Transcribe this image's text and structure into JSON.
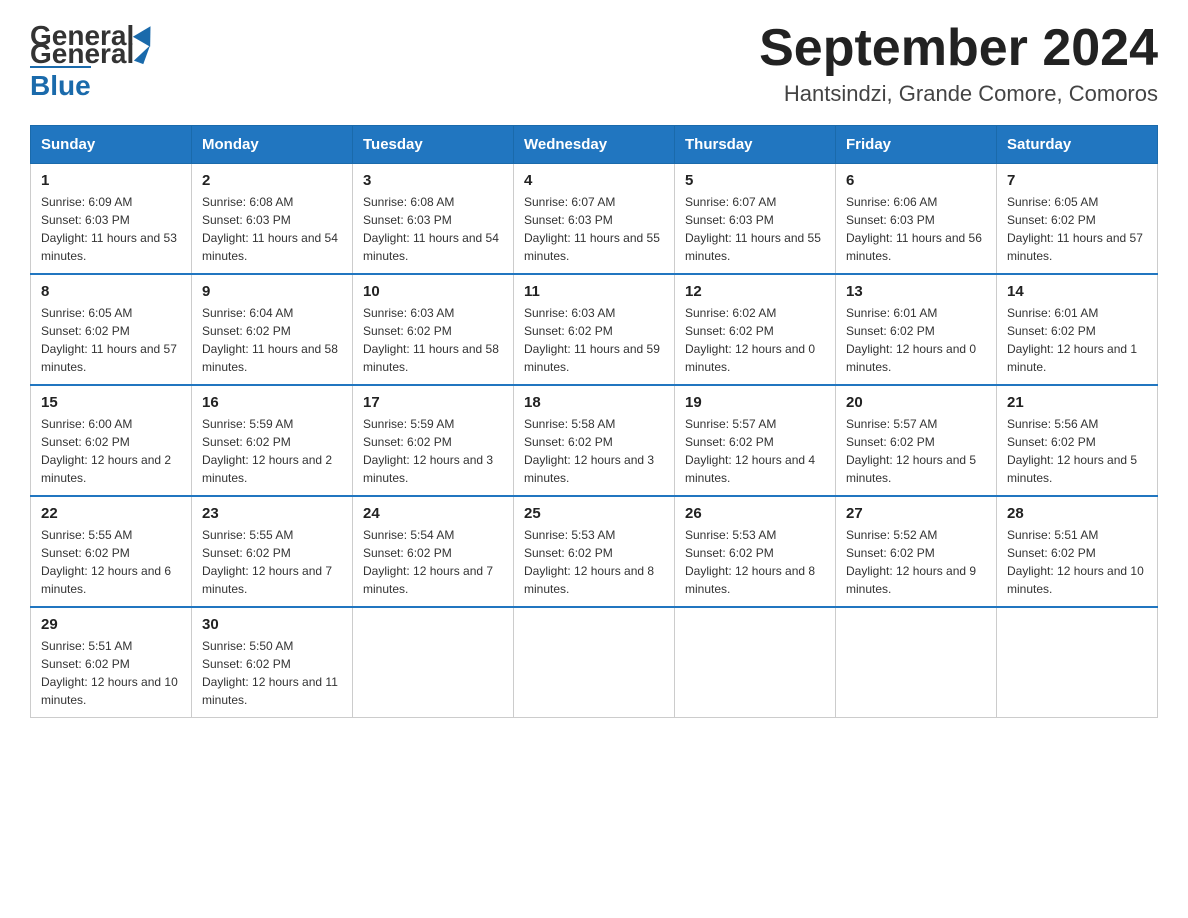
{
  "logo": {
    "text_general": "General",
    "text_blue": "Blue"
  },
  "title": "September 2024",
  "location": "Hantsindzi, Grande Comore, Comoros",
  "weekdays": [
    "Sunday",
    "Monday",
    "Tuesday",
    "Wednesday",
    "Thursday",
    "Friday",
    "Saturday"
  ],
  "weeks": [
    [
      {
        "day": "1",
        "sunrise": "6:09 AM",
        "sunset": "6:03 PM",
        "daylight": "11 hours and 53 minutes."
      },
      {
        "day": "2",
        "sunrise": "6:08 AM",
        "sunset": "6:03 PM",
        "daylight": "11 hours and 54 minutes."
      },
      {
        "day": "3",
        "sunrise": "6:08 AM",
        "sunset": "6:03 PM",
        "daylight": "11 hours and 54 minutes."
      },
      {
        "day": "4",
        "sunrise": "6:07 AM",
        "sunset": "6:03 PM",
        "daylight": "11 hours and 55 minutes."
      },
      {
        "day": "5",
        "sunrise": "6:07 AM",
        "sunset": "6:03 PM",
        "daylight": "11 hours and 55 minutes."
      },
      {
        "day": "6",
        "sunrise": "6:06 AM",
        "sunset": "6:03 PM",
        "daylight": "11 hours and 56 minutes."
      },
      {
        "day": "7",
        "sunrise": "6:05 AM",
        "sunset": "6:02 PM",
        "daylight": "11 hours and 57 minutes."
      }
    ],
    [
      {
        "day": "8",
        "sunrise": "6:05 AM",
        "sunset": "6:02 PM",
        "daylight": "11 hours and 57 minutes."
      },
      {
        "day": "9",
        "sunrise": "6:04 AM",
        "sunset": "6:02 PM",
        "daylight": "11 hours and 58 minutes."
      },
      {
        "day": "10",
        "sunrise": "6:03 AM",
        "sunset": "6:02 PM",
        "daylight": "11 hours and 58 minutes."
      },
      {
        "day": "11",
        "sunrise": "6:03 AM",
        "sunset": "6:02 PM",
        "daylight": "11 hours and 59 minutes."
      },
      {
        "day": "12",
        "sunrise": "6:02 AM",
        "sunset": "6:02 PM",
        "daylight": "12 hours and 0 minutes."
      },
      {
        "day": "13",
        "sunrise": "6:01 AM",
        "sunset": "6:02 PM",
        "daylight": "12 hours and 0 minutes."
      },
      {
        "day": "14",
        "sunrise": "6:01 AM",
        "sunset": "6:02 PM",
        "daylight": "12 hours and 1 minute."
      }
    ],
    [
      {
        "day": "15",
        "sunrise": "6:00 AM",
        "sunset": "6:02 PM",
        "daylight": "12 hours and 2 minutes."
      },
      {
        "day": "16",
        "sunrise": "5:59 AM",
        "sunset": "6:02 PM",
        "daylight": "12 hours and 2 minutes."
      },
      {
        "day": "17",
        "sunrise": "5:59 AM",
        "sunset": "6:02 PM",
        "daylight": "12 hours and 3 minutes."
      },
      {
        "day": "18",
        "sunrise": "5:58 AM",
        "sunset": "6:02 PM",
        "daylight": "12 hours and 3 minutes."
      },
      {
        "day": "19",
        "sunrise": "5:57 AM",
        "sunset": "6:02 PM",
        "daylight": "12 hours and 4 minutes."
      },
      {
        "day": "20",
        "sunrise": "5:57 AM",
        "sunset": "6:02 PM",
        "daylight": "12 hours and 5 minutes."
      },
      {
        "day": "21",
        "sunrise": "5:56 AM",
        "sunset": "6:02 PM",
        "daylight": "12 hours and 5 minutes."
      }
    ],
    [
      {
        "day": "22",
        "sunrise": "5:55 AM",
        "sunset": "6:02 PM",
        "daylight": "12 hours and 6 minutes."
      },
      {
        "day": "23",
        "sunrise": "5:55 AM",
        "sunset": "6:02 PM",
        "daylight": "12 hours and 7 minutes."
      },
      {
        "day": "24",
        "sunrise": "5:54 AM",
        "sunset": "6:02 PM",
        "daylight": "12 hours and 7 minutes."
      },
      {
        "day": "25",
        "sunrise": "5:53 AM",
        "sunset": "6:02 PM",
        "daylight": "12 hours and 8 minutes."
      },
      {
        "day": "26",
        "sunrise": "5:53 AM",
        "sunset": "6:02 PM",
        "daylight": "12 hours and 8 minutes."
      },
      {
        "day": "27",
        "sunrise": "5:52 AM",
        "sunset": "6:02 PM",
        "daylight": "12 hours and 9 minutes."
      },
      {
        "day": "28",
        "sunrise": "5:51 AM",
        "sunset": "6:02 PM",
        "daylight": "12 hours and 10 minutes."
      }
    ],
    [
      {
        "day": "29",
        "sunrise": "5:51 AM",
        "sunset": "6:02 PM",
        "daylight": "12 hours and 10 minutes."
      },
      {
        "day": "30",
        "sunrise": "5:50 AM",
        "sunset": "6:02 PM",
        "daylight": "12 hours and 11 minutes."
      },
      null,
      null,
      null,
      null,
      null
    ]
  ],
  "labels": {
    "sunrise": "Sunrise:",
    "sunset": "Sunset:",
    "daylight": "Daylight:"
  }
}
